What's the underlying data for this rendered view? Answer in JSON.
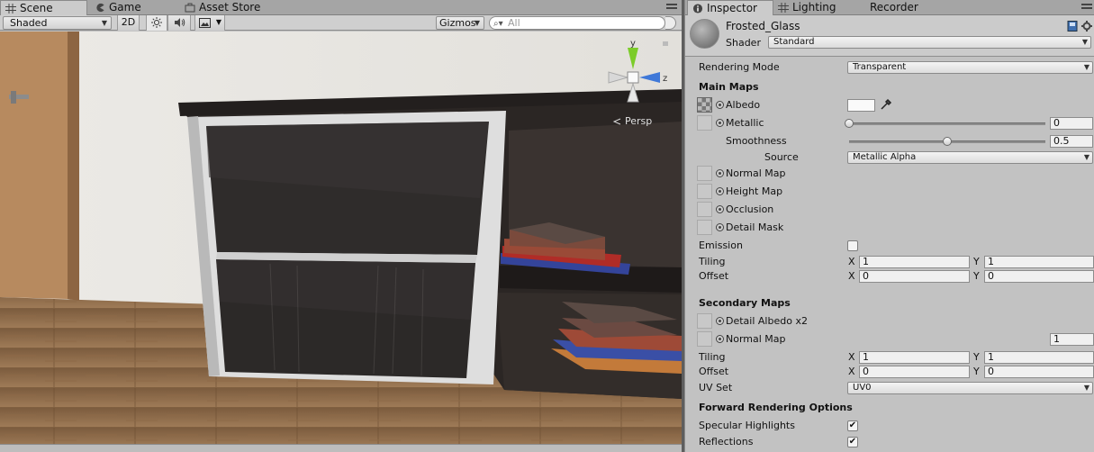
{
  "scene_tabs": [
    {
      "label": "Scene",
      "icon": "grid-icon"
    },
    {
      "label": "Game",
      "icon": "pacman-icon"
    },
    {
      "label": "Asset Store",
      "icon": "store-icon"
    }
  ],
  "scene_toolbar": {
    "draw_mode": "Shaded",
    "mode_2d": "2D",
    "lighting_icon": "sun-icon",
    "audio_icon": "speaker-icon",
    "effects_icon": "image-icon",
    "gizmos": "Gizmos",
    "search_placeholder": "All"
  },
  "scene_view": {
    "projection_label": "Persp",
    "gizmo_axes": {
      "y": "y",
      "z": "z"
    },
    "colors": {
      "wall": "#e9e7e2",
      "floor": "#8a6a4a",
      "door": "#b88a5e",
      "cabinet_top": "#2a2524",
      "frame": "#dcdcdc",
      "glass": "#2e2b2a",
      "axis_y": "#7ccc2a",
      "axis_z": "#3f78d8"
    }
  },
  "inspector_tabs": [
    {
      "label": "Inspector",
      "icon": "info-icon"
    },
    {
      "label": "Lighting",
      "icon": "lighting-icon"
    },
    {
      "label": "Recorder",
      "icon": ""
    }
  ],
  "material": {
    "name": "Frosted_Glass",
    "shader_label": "Shader",
    "shader_value": "Standard"
  },
  "properties": {
    "rendering_mode_label": "Rendering Mode",
    "rendering_mode_value": "Transparent",
    "main_maps_header": "Main Maps",
    "albedo": "Albedo",
    "metallic": "Metallic",
    "metallic_value": "0",
    "metallic_fraction": 0.0,
    "smoothness": "Smoothness",
    "smoothness_value": "0.5",
    "smoothness_fraction": 0.5,
    "source_label": "Source",
    "source_value": "Metallic Alpha",
    "normal_map": "Normal Map",
    "height_map": "Height Map",
    "occlusion": "Occlusion",
    "detail_mask": "Detail Mask",
    "emission": "Emission",
    "tiling": "Tiling",
    "offset": "Offset",
    "x": "X",
    "y": "Y",
    "main_tiling_x": "1",
    "main_tiling_y": "1",
    "main_offset_x": "0",
    "main_offset_y": "0",
    "secondary_maps_header": "Secondary Maps",
    "detail_albedo": "Detail Albedo x2",
    "secondary_normal_map": "Normal Map",
    "secondary_normal_scale": "1",
    "sec_tiling_x": "1",
    "sec_tiling_y": "1",
    "sec_offset_x": "0",
    "sec_offset_y": "0",
    "uv_set_label": "UV Set",
    "uv_set_value": "UV0",
    "forward_header": "Forward Rendering Options",
    "specular_highlights": "Specular Highlights",
    "reflections": "Reflections",
    "check_mark": "✔"
  }
}
